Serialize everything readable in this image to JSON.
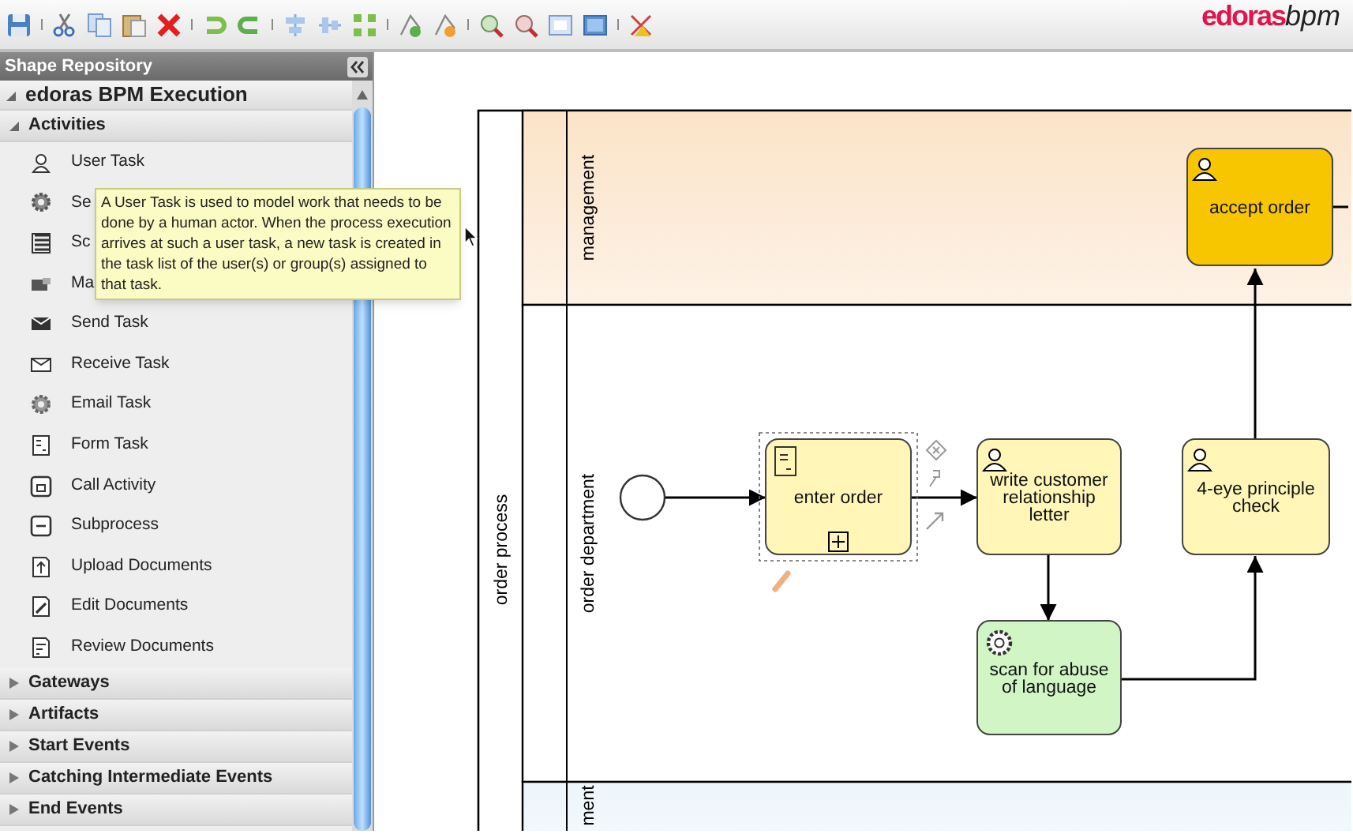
{
  "logo": {
    "brand": "edoras",
    "product": "bpm"
  },
  "sidebar": {
    "title": "Shape Repository",
    "groups": [
      {
        "label": "edoras BPM Execution",
        "expanded": true,
        "children": [
          {
            "label": "Activities",
            "expanded": true,
            "children": [
              {
                "label": "User Task",
                "kind": "user"
              },
              {
                "label": "Se",
                "kind": "service"
              },
              {
                "label": "Sc",
                "kind": "script"
              },
              {
                "label": "Ma",
                "kind": "manual"
              },
              {
                "label": "Send Task",
                "kind": "send"
              },
              {
                "label": "Receive Task",
                "kind": "receive"
              },
              {
                "label": "Email Task",
                "kind": "email"
              },
              {
                "label": "Form Task",
                "kind": "form"
              },
              {
                "label": "Call Activity",
                "kind": "call"
              },
              {
                "label": "Subprocess",
                "kind": "subprocess"
              },
              {
                "label": "Upload Documents",
                "kind": "upload"
              },
              {
                "label": "Edit Documents",
                "kind": "edit"
              },
              {
                "label": "Review Documents",
                "kind": "review"
              }
            ]
          },
          {
            "label": "Gateways",
            "expanded": false
          },
          {
            "label": "Artifacts",
            "expanded": false
          },
          {
            "label": "Start Events",
            "expanded": false
          },
          {
            "label": "Catching Intermediate Events",
            "expanded": false
          },
          {
            "label": "End Events",
            "expanded": false
          }
        ]
      }
    ]
  },
  "tooltip": {
    "text": "A User Task is used to model work that needs to be done by a human actor. When the process execution arrives at such a user task, a new task is created in the task list of the user(s) or group(s) assigned to that task."
  },
  "diagram": {
    "pool": "order process",
    "lanes": [
      {
        "label": "management"
      },
      {
        "label": "order department"
      },
      {
        "label": "ment"
      }
    ],
    "nodes": [
      {
        "kind": "user_task",
        "label": "accept order",
        "color": "#f7c600",
        "selected": false
      },
      {
        "kind": "start_event"
      },
      {
        "kind": "form_task",
        "label": "enter order",
        "color": "#fff6b8",
        "selected": true
      },
      {
        "kind": "user_task",
        "label": "write customer relationship letter",
        "color": "#fff6b8",
        "selected": false
      },
      {
        "kind": "user_task",
        "label": "4-eye principle check",
        "color": "#fff6b8",
        "selected": false
      },
      {
        "kind": "service_task",
        "label": "scan for abuse of language",
        "color": "#d2f5c6",
        "selected": false
      }
    ]
  }
}
